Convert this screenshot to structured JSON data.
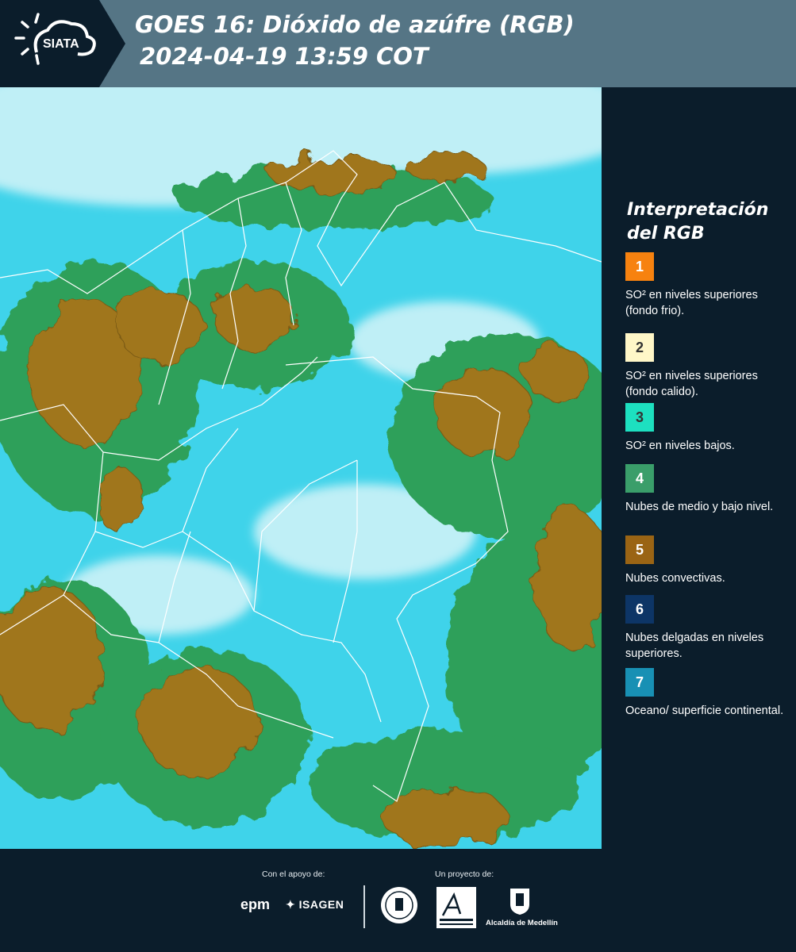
{
  "header": {
    "logo_text": "SIATA",
    "title_line1": "GOES 16: Dióxido de azúfre (RGB)",
    "title_line2": "2024-04-19 13:59 COT"
  },
  "legend": {
    "title": "Interpretación del RGB",
    "items": [
      {
        "number": "1",
        "color": "#f7820f",
        "text_color": "#ffffff",
        "label": "SO² en niveles superiores (fondo frio)."
      },
      {
        "number": "2",
        "color": "#fff7c8",
        "text_color": "#333333",
        "label": "SO² en niveles superiores (fondo calido)."
      },
      {
        "number": "3",
        "color": "#1de0c0",
        "text_color": "#333333",
        "label": "SO² en niveles bajos."
      },
      {
        "number": "4",
        "color": "#3a9e6a",
        "text_color": "#ffffff",
        "label": "Nubes de medio y bajo nivel."
      },
      {
        "number": "5",
        "color": "#9a6414",
        "text_color": "#ffffff",
        "label": "Nubes convectivas."
      },
      {
        "number": "6",
        "color": "#0d3566",
        "text_color": "#ffffff",
        "label": "Nubes delgadas en niveles superiores."
      },
      {
        "number": "7",
        "color": "#1890b4",
        "text_color": "#ffffff",
        "label": "Oceano/ superficie continental."
      }
    ]
  },
  "footer": {
    "support_label": "Con el apoyo de:",
    "project_label": "Un proyecto de:",
    "epm": "epm",
    "isagen": "ISAGEN",
    "alcaldia": "Alcaldía de Medellín"
  },
  "map": {
    "colors": {
      "background": "#3fd3ea",
      "haze": "#bfeff6",
      "low_cloud": "#2fa05a",
      "convective": "#a0761c",
      "convective_dark": "#7a5a12",
      "borders": "#ffffff"
    }
  }
}
